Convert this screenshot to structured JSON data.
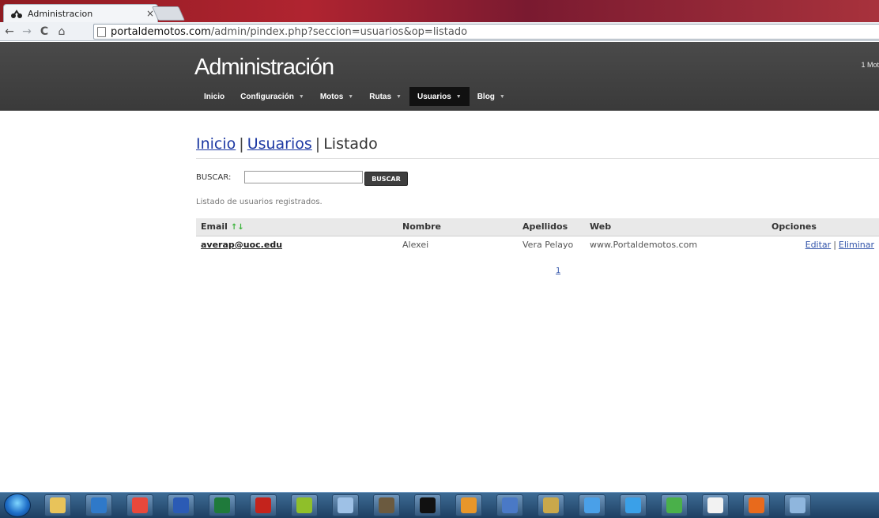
{
  "browser": {
    "tab_title": "Administracion",
    "tab_close": "×",
    "back": "←",
    "forward": "→",
    "reload": "C",
    "home": "⌂",
    "url_host": "portaldemotos.com",
    "url_path": "/admin/pindex.php?seccion=usuarios&op=listado"
  },
  "header": {
    "brand": "Administración",
    "right_text": "1 Mot",
    "menu": [
      {
        "label": "Inicio",
        "has_caret": false
      },
      {
        "label": "Configuración",
        "has_caret": true
      },
      {
        "label": "Motos",
        "has_caret": true
      },
      {
        "label": "Rutas",
        "has_caret": true
      },
      {
        "label": "Usuarios",
        "has_caret": true,
        "active": true
      },
      {
        "label": "Blog",
        "has_caret": true
      }
    ],
    "caret": "▼"
  },
  "breadcrumb": {
    "home": "Inicio",
    "section": "Usuarios",
    "current": "Listado",
    "separator": "|"
  },
  "search": {
    "label": "BUSCAR:",
    "value": "",
    "button": "BUSCAR"
  },
  "description": "Listado de usuarios registrados.",
  "table": {
    "columns": [
      "Email",
      "Nombre",
      "Apellidos",
      "Web",
      "Opciones"
    ],
    "sort_icon": "↑↓",
    "rows": [
      {
        "email": "averap@uoc.edu",
        "nombre": "Alexei",
        "apellidos": "Vera Pelayo",
        "web": "www.Portaldemotos.com",
        "edit": "Editar",
        "delete": "Eliminar"
      }
    ],
    "options_separator": "|"
  },
  "pagination": {
    "pages": [
      "1"
    ]
  },
  "taskbar": {
    "icons": [
      {
        "name": "explorer-icon",
        "color": "#e8c35a"
      },
      {
        "name": "outlook-icon",
        "color": "#2f79c9"
      },
      {
        "name": "chrome-icon",
        "color": "#e8483b"
      },
      {
        "name": "word-icon",
        "color": "#2b5bb5"
      },
      {
        "name": "excel-icon",
        "color": "#1f7a3b"
      },
      {
        "name": "filezilla-icon",
        "color": "#c4231c"
      },
      {
        "name": "dreamweaver-icon",
        "color": "#8fbf2a"
      },
      {
        "name": "notepad-icon",
        "color": "#9ec1e6"
      },
      {
        "name": "gimp-icon",
        "color": "#6b5a3f"
      },
      {
        "name": "console-icon",
        "color": "#111111"
      },
      {
        "name": "sublime-icon",
        "color": "#e8962a"
      },
      {
        "name": "vb-icon",
        "color": "#4a79c6"
      },
      {
        "name": "tool-icon",
        "color": "#c9a84b"
      },
      {
        "name": "network-icon",
        "color": "#4aa0e8"
      },
      {
        "name": "ie-icon",
        "color": "#3aa0e8"
      },
      {
        "name": "utorrent-icon",
        "color": "#4ab04a"
      },
      {
        "name": "xming-icon",
        "color": "#f2f2f2"
      },
      {
        "name": "firefox-icon",
        "color": "#e86a1c"
      },
      {
        "name": "paint-icon",
        "color": "#8fb6dd"
      },
      {
        "name": "extra-icon",
        "color": "#a7c7e6"
      }
    ]
  }
}
